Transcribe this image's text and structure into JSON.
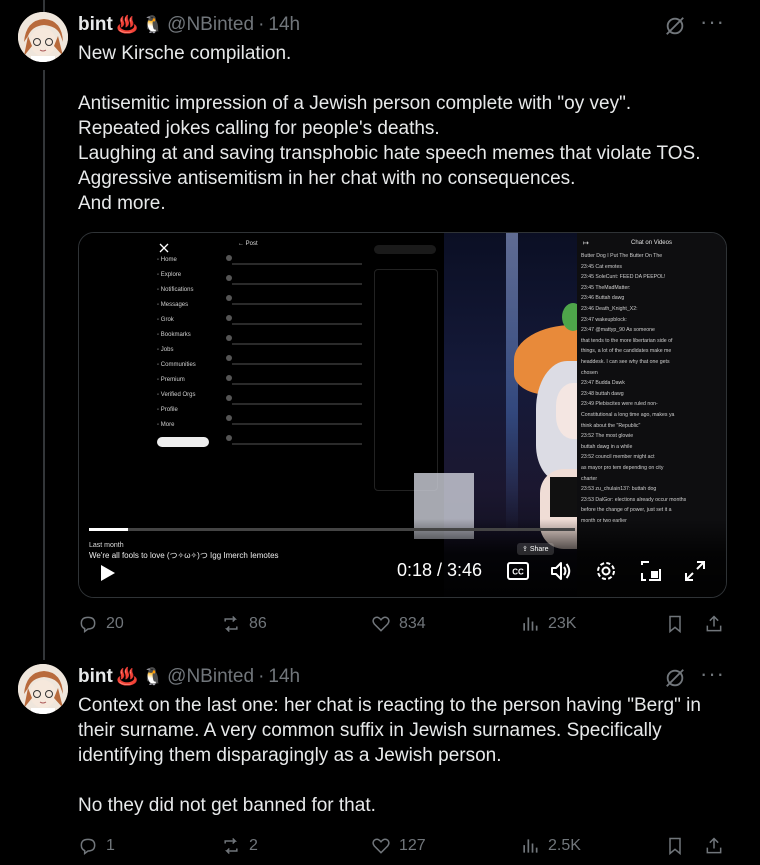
{
  "tweets": [
    {
      "name": "bint",
      "emoji1": "♨️",
      "emoji2": "🐧",
      "handle": "@NBinted",
      "separator": "·",
      "time": "14h",
      "text": "New Kirsche compilation.\n\nAntisemitic impression of a Jewish person complete with \"oy vey\".\nRepeated jokes calling for people's deaths.\nLaughing at and saving transphobic hate speech memes that violate TOS.\nAggressive antisemitism in her chat with no consequences.\nAnd more.",
      "replies": "20",
      "reposts": "86",
      "likes": "834",
      "views": "23K"
    },
    {
      "name": "bint",
      "emoji1": "♨️",
      "emoji2": "🐧",
      "handle": "@NBinted",
      "separator": "·",
      "time": "14h",
      "text": "Context on the last one: her chat is reacting to the person having \"Berg\" in their surname. A very common suffix in Jewish surnames. Specifically identifying them disparagingly as a Jewish person.\n\nNo they did not get banned for that.",
      "replies": "1",
      "reposts": "2",
      "likes": "127",
      "views": "2.5K"
    }
  ],
  "video": {
    "last_month": "Last month",
    "title": "We're all fools to love (つ✧ω✧)つ Igg Imerch Iemotes",
    "share": "Share",
    "timecode": "0:18 / 3:46",
    "progress": 0.08,
    "chat_title": "Chat on Videos",
    "nav": [
      "Home",
      "Explore",
      "Notifications",
      "Messages",
      "Grok",
      "Bookmarks",
      "Jobs",
      "Communities",
      "Premium",
      "Verified Orgs",
      "Profile",
      "More"
    ],
    "chat_lines": [
      "Butter Dog  I Put The Butter On The",
      "23:45  Cat emotes",
      "23:45  SoleCunt: FEED DA PEEPOL!",
      "23:45  TheMadMatter:",
      "23:46  Buttah dawg",
      "23:46  Death_Knight_X2:",
      "23:47  wakeupblock:",
      "23:47  @mattyp_90 As someone",
      "that tends to the more libertarian side of",
      "things, a lot of the candidates make me",
      "headdesk. I can see why that one gets",
      "chosen",
      "23:47  Budda Dawk",
      "23:48  buttah dawg",
      "23:49  Plebiscites were ruled non-",
      "Constitutional a long time ago, makes ya",
      "think about the \"Republic\"",
      "23:52  The most glowie",
      "buttah dawg in a while",
      "23:52  council member might act",
      "as mayor pro tem depending on city",
      "charter",
      "23:53  zu_chulain137: buttah dog",
      "23:53  DalGor: elections already occur months",
      "before the change of power, just set it a",
      "month or two earlier"
    ]
  }
}
